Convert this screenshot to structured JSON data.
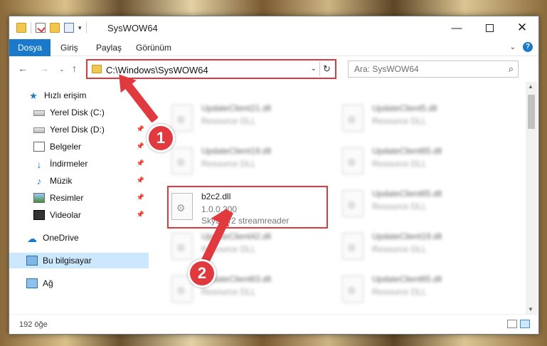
{
  "window": {
    "title": "SysWOW64",
    "controls": {
      "minimize": "—",
      "close": "✕"
    }
  },
  "ribbon": {
    "tabs": [
      "Dosya",
      "Giriş",
      "Paylaş",
      "Görünüm"
    ],
    "help": "?"
  },
  "address": {
    "path": "C:\\Windows\\SysWOW64",
    "search_placeholder": "Ara: SysWOW64"
  },
  "sidebar": {
    "items": [
      {
        "label": "Hızlı erişim",
        "icon": "star-icon"
      },
      {
        "label": "Yerel Disk (C:)",
        "icon": "drive-icon"
      },
      {
        "label": "Yerel Disk (D:)",
        "icon": "drive-icon"
      },
      {
        "label": "Belgeler",
        "icon": "documents-icon"
      },
      {
        "label": "İndirmeler",
        "icon": "downloads-icon"
      },
      {
        "label": "Müzik",
        "icon": "music-icon"
      },
      {
        "label": "Resimler",
        "icon": "pictures-icon"
      },
      {
        "label": "Videolar",
        "icon": "videos-icon"
      },
      {
        "label": "OneDrive",
        "icon": "onedrive-icon"
      },
      {
        "label": "Bu bilgisayar",
        "icon": "this-pc-icon"
      },
      {
        "label": "Ağ",
        "icon": "network-icon"
      }
    ]
  },
  "files": {
    "blurred": [
      {
        "name": "UpdateClient21.dll",
        "desc": "Resource DLL"
      },
      {
        "name": "UpdateClient5.dll",
        "desc": "Resource DLL"
      },
      {
        "name": "UpdateClient19.dll",
        "desc": "Resource DLL"
      },
      {
        "name": "UpdateClient65.dll",
        "desc": "Resource DLL"
      },
      {
        "name": "UpdateClient65.dll",
        "desc": "Resource DLL"
      },
      {
        "name": "UpdateClient42.dll",
        "desc": "Resource DLL"
      },
      {
        "name": "UpdateClient19.dll",
        "desc": "Resource DLL"
      },
      {
        "name": "UpdateClient63.dll",
        "desc": "Resource DLL"
      },
      {
        "name": "UpdateClient65.dll",
        "desc": "Resource DLL"
      }
    ],
    "highlighted": {
      "name": "b2c2.dll",
      "version": "1.0.0.200",
      "desc": "SkyStar2 streamreader"
    }
  },
  "status": {
    "count": "192 öğe"
  },
  "annotations": {
    "step1": "1",
    "step2": "2",
    "color": "#e0393e"
  }
}
